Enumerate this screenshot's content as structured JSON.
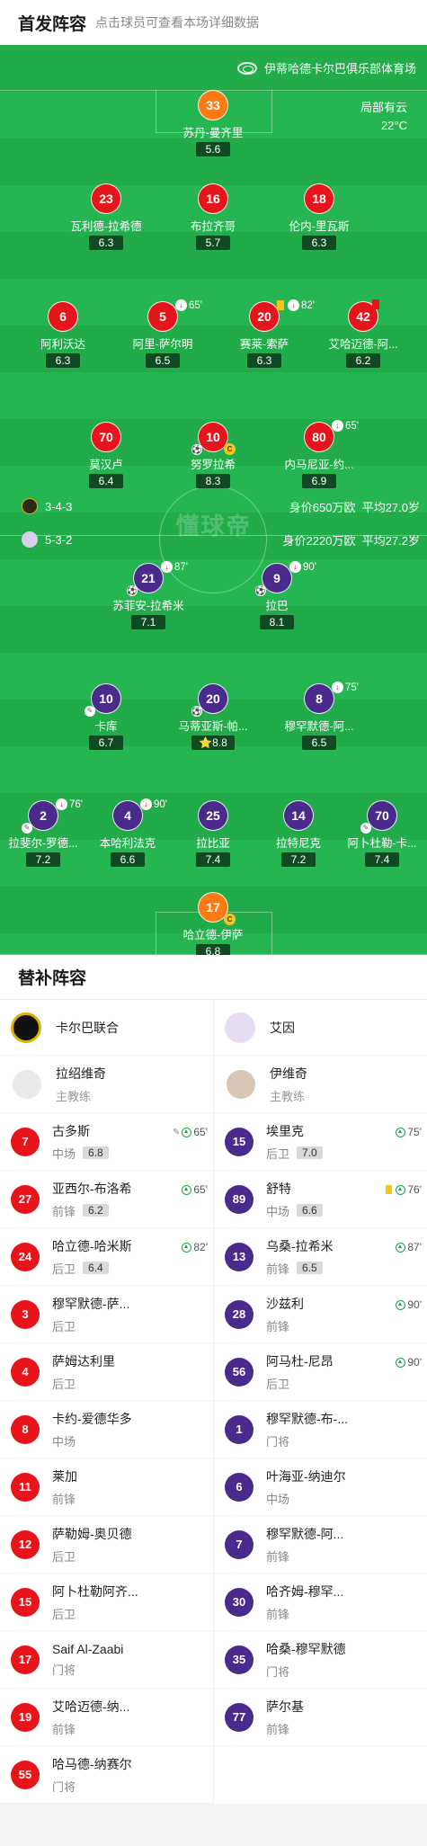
{
  "header": {
    "title": "首发阵容",
    "subtitle": "点击球员可查看本场详细数据"
  },
  "pitch": {
    "venue": "伊蒂哈德卡尔巴俱乐部体育场",
    "weather": "局部有云",
    "temperature": "22°C",
    "watermark": "懂球帝",
    "home_formation": "3-4-3",
    "home_value": "身价650万欧",
    "home_age": "平均27.0岁",
    "away_formation": "5-3-2",
    "away_value": "身价2220万欧",
    "away_age": "平均27.2岁"
  },
  "home_players": [
    {
      "num": "33",
      "name": "苏丹-曼齐里",
      "rating": "5.6",
      "gk": true
    },
    {
      "num": "23",
      "name": "瓦利德-拉希德",
      "rating": "6.3"
    },
    {
      "num": "16",
      "name": "布拉齐哥",
      "rating": "5.7"
    },
    {
      "num": "18",
      "name": "伦内-里瓦斯",
      "rating": "6.3"
    },
    {
      "num": "6",
      "name": "阿利沃达",
      "rating": "6.3"
    },
    {
      "num": "5",
      "name": "阿里-萨尔明",
      "rating": "6.5",
      "sub": "65'"
    },
    {
      "num": "20",
      "name": "赛莱-索萨",
      "rating": "6.3",
      "sub": "82'"
    },
    {
      "num": "42",
      "name": "艾哈迈德-阿...",
      "rating": "6.2"
    },
    {
      "num": "70",
      "name": "莫汉卢",
      "rating": "6.4"
    },
    {
      "num": "10",
      "name": "努罗拉希",
      "rating": "8.3"
    },
    {
      "num": "80",
      "name": "内马尼亚-约...",
      "rating": "6.9",
      "sub": "65'"
    }
  ],
  "away_players": [
    {
      "num": "21",
      "name": "苏菲安-拉希米",
      "rating": "7.1",
      "sub": "87'"
    },
    {
      "num": "9",
      "name": "拉巴",
      "rating": "8.1",
      "sub": "90'"
    },
    {
      "num": "10",
      "name": "卡库",
      "rating": "6.7"
    },
    {
      "num": "20",
      "name": "马蒂亚斯-帕...",
      "rating": "8.8"
    },
    {
      "num": "8",
      "name": "穆罕默德-阿...",
      "rating": "6.5",
      "sub": "75'"
    },
    {
      "num": "2",
      "name": "拉斐尔-罗德...",
      "rating": "7.2",
      "sub": "76'"
    },
    {
      "num": "4",
      "name": "本哈利法克",
      "rating": "6.6",
      "sub": "90'"
    },
    {
      "num": "25",
      "name": "拉比亚",
      "rating": "7.4"
    },
    {
      "num": "14",
      "name": "拉特尼克",
      "rating": "7.2"
    },
    {
      "num": "70",
      "name": "阿卜杜勒-卡...",
      "rating": "7.4"
    },
    {
      "num": "17",
      "name": "哈立德-伊萨",
      "rating": "6.8",
      "gk": true
    }
  ],
  "subs": {
    "title": "替补阵容",
    "home": {
      "team": "卡尔巴联合",
      "coach": "拉绍维奇",
      "coach_role": "主教练",
      "players": [
        {
          "num": "7",
          "name": "古多斯",
          "pos": "中场",
          "rating": "6.8",
          "time": "65'",
          "assist": true
        },
        {
          "num": "27",
          "name": "亚西尔-布洛希",
          "pos": "前锋",
          "rating": "6.2",
          "time": "65'"
        },
        {
          "num": "24",
          "name": "哈立德-哈米斯",
          "pos": "后卫",
          "rating": "6.4",
          "time": "82'"
        },
        {
          "num": "3",
          "name": "穆罕默德-萨...",
          "pos": "后卫"
        },
        {
          "num": "4",
          "name": "萨姆达利里",
          "pos": "后卫"
        },
        {
          "num": "8",
          "name": "卡约-爱德华多",
          "pos": "中场"
        },
        {
          "num": "11",
          "name": "莱加",
          "pos": "前锋"
        },
        {
          "num": "12",
          "name": "萨勒姆-奥贝德",
          "pos": "后卫"
        },
        {
          "num": "15",
          "name": "阿卜杜勒阿齐...",
          "pos": "后卫"
        },
        {
          "num": "17",
          "name": "Saif Al-Zaabi",
          "pos": "门将"
        },
        {
          "num": "19",
          "name": "艾哈迈德-纳...",
          "pos": "前锋"
        },
        {
          "num": "55",
          "name": "哈马德-纳赛尔",
          "pos": "门将"
        }
      ]
    },
    "away": {
      "team": "艾因",
      "coach": "伊维奇",
      "coach_role": "主教练",
      "players": [
        {
          "num": "15",
          "name": "埃里克",
          "pos": "后卫",
          "rating": "7.0",
          "time": "75'"
        },
        {
          "num": "89",
          "name": "舒特",
          "pos": "中场",
          "rating": "6.6",
          "time": "76'",
          "card": true
        },
        {
          "num": "13",
          "name": "乌桑-拉希米",
          "pos": "前锋",
          "rating": "6.5",
          "time": "87'"
        },
        {
          "num": "28",
          "name": "沙兹利",
          "pos": "前锋",
          "time": "90'"
        },
        {
          "num": "56",
          "name": "阿马杜-尼昂",
          "pos": "后卫",
          "time": "90'"
        },
        {
          "num": "1",
          "name": "穆罕默德-布-...",
          "pos": "门将"
        },
        {
          "num": "6",
          "name": "叶海亚-纳迪尔",
          "pos": "中场"
        },
        {
          "num": "7",
          "name": "穆罕默德-阿...",
          "pos": "前锋"
        },
        {
          "num": "30",
          "name": "哈齐姆-穆罕...",
          "pos": "前锋"
        },
        {
          "num": "35",
          "name": "哈桑-穆罕默德",
          "pos": "门将"
        },
        {
          "num": "77",
          "name": "萨尔基",
          "pos": "前锋"
        }
      ]
    }
  },
  "colors": {
    "home": "#e8141c",
    "away": "#4a2b8c",
    "gk": "#ff7a14",
    "pitch": "#22b14c"
  }
}
